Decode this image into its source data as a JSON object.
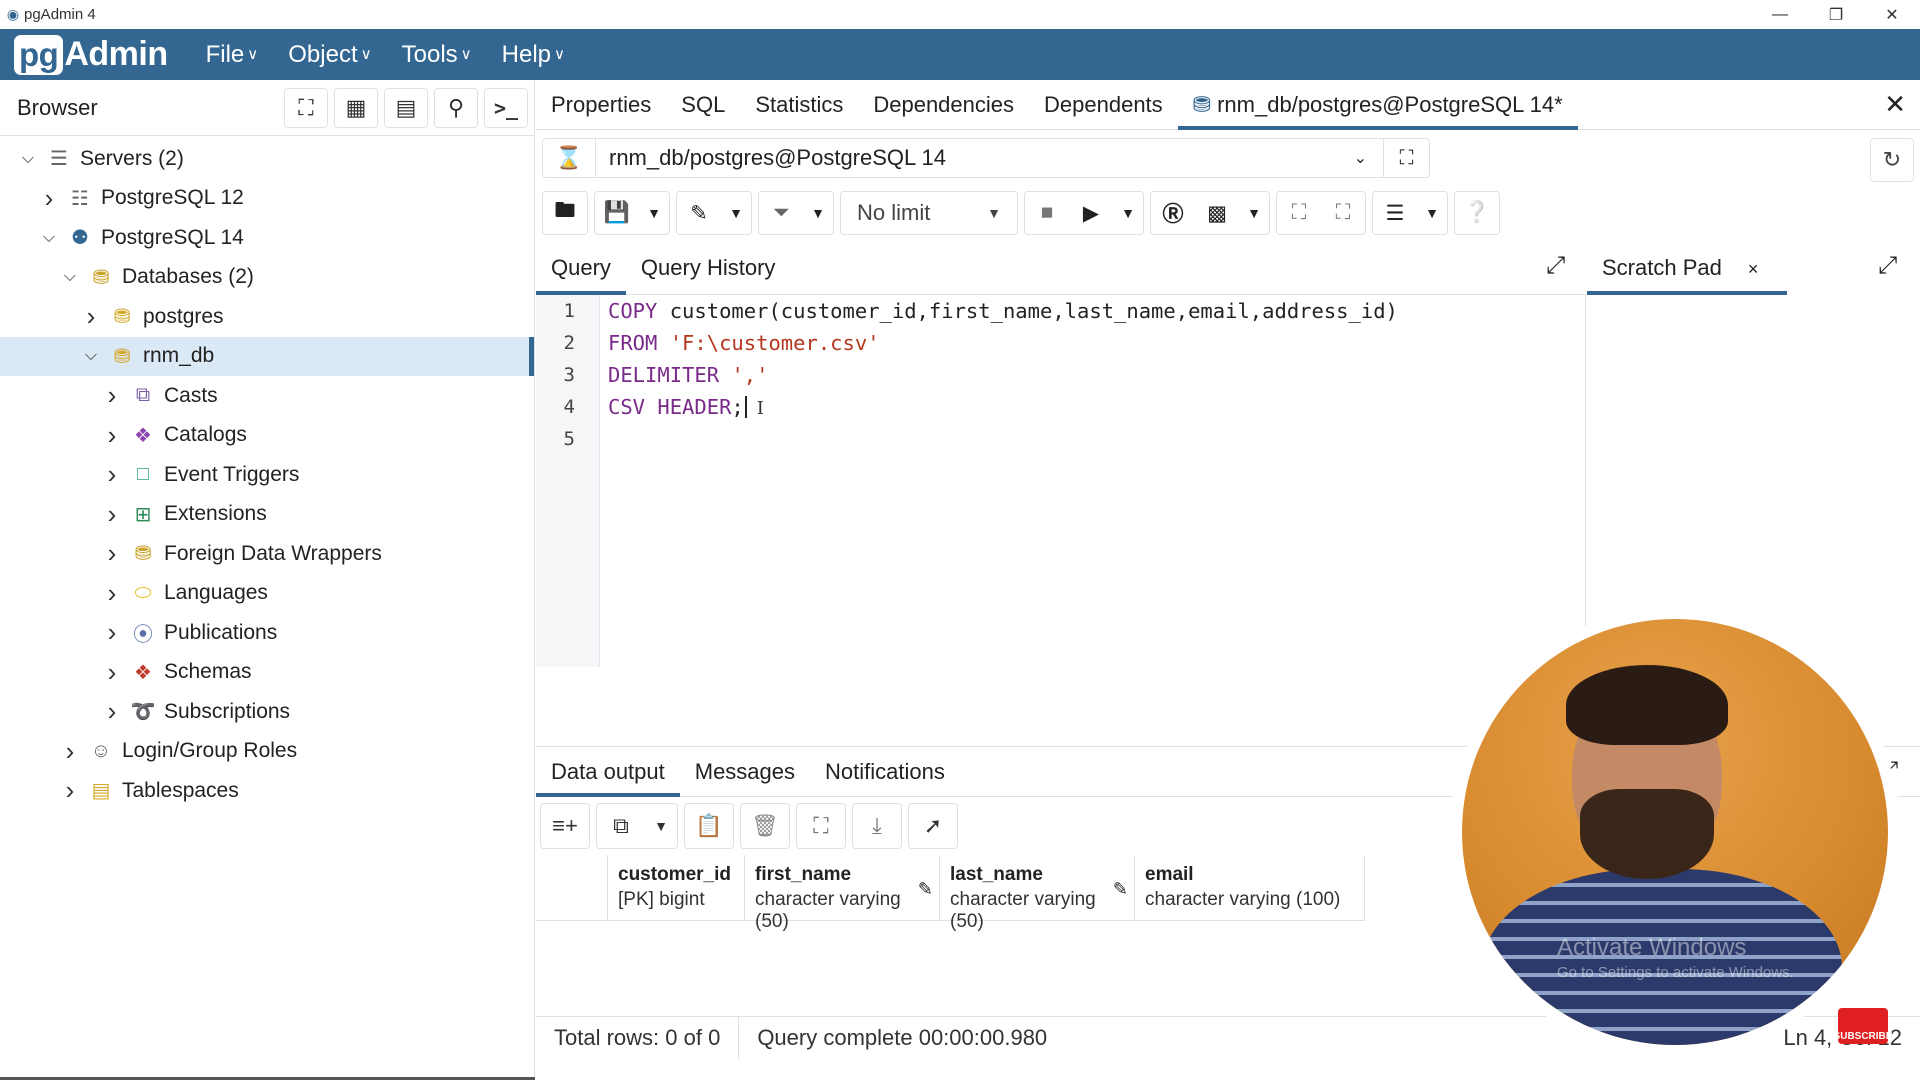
{
  "window": {
    "title": "pgAdmin 4",
    "controls": {
      "minimize": "—",
      "maximize": "❐",
      "close": "✕"
    }
  },
  "menubar": {
    "logo_pg": "pg",
    "logo_text": "Admin",
    "items": [
      "File",
      "Object",
      "Tools",
      "Help"
    ]
  },
  "browser": {
    "title": "Browser",
    "tree": [
      {
        "label": "Servers (2)",
        "icon": "servers-icon",
        "level": 0,
        "expanded": true
      },
      {
        "label": "PostgreSQL 12",
        "icon": "server-disconnected-icon",
        "level": 1,
        "expanded": false
      },
      {
        "label": "PostgreSQL 14",
        "icon": "elephant-icon",
        "level": 1,
        "expanded": true
      },
      {
        "label": "Databases (2)",
        "icon": "databases-icon",
        "level": 2,
        "expanded": true
      },
      {
        "label": "postgres",
        "icon": "database-icon",
        "level": 3,
        "expanded": false
      },
      {
        "label": "rnm_db",
        "icon": "database-icon",
        "level": 3,
        "expanded": true,
        "selected": true
      },
      {
        "label": "Casts",
        "icon": "casts-icon",
        "level": 4,
        "expanded": false
      },
      {
        "label": "Catalogs",
        "icon": "catalogs-icon",
        "level": 4,
        "expanded": false
      },
      {
        "label": "Event Triggers",
        "icon": "event-triggers-icon",
        "level": 4,
        "expanded": false
      },
      {
        "label": "Extensions",
        "icon": "extensions-icon",
        "level": 4,
        "expanded": false
      },
      {
        "label": "Foreign Data Wrappers",
        "icon": "fdw-icon",
        "level": 4,
        "expanded": false
      },
      {
        "label": "Languages",
        "icon": "languages-icon",
        "level": 4,
        "expanded": false
      },
      {
        "label": "Publications",
        "icon": "publications-icon",
        "level": 4,
        "expanded": false
      },
      {
        "label": "Schemas",
        "icon": "schemas-icon",
        "level": 4,
        "expanded": false
      },
      {
        "label": "Subscriptions",
        "icon": "subscriptions-icon",
        "level": 4,
        "expanded": false
      },
      {
        "label": "Login/Group Roles",
        "icon": "roles-icon",
        "level": 2,
        "expanded": false
      },
      {
        "label": "Tablespaces",
        "icon": "tablespaces-icon",
        "level": 2,
        "expanded": false
      }
    ]
  },
  "main_tabs": [
    {
      "label": "Properties"
    },
    {
      "label": "SQL"
    },
    {
      "label": "Statistics"
    },
    {
      "label": "Dependencies"
    },
    {
      "label": "Dependents"
    },
    {
      "label": "rnm_db/postgres@PostgreSQL 14*",
      "active": true
    }
  ],
  "connection": {
    "value": "rnm_db/postgres@PostgreSQL 14"
  },
  "toolbar": {
    "limit": "No limit"
  },
  "query_tabs": {
    "query": "Query",
    "history": "Query History"
  },
  "scratch_pad": {
    "label": "Scratch Pad",
    "close": "×"
  },
  "editor": {
    "lines": [
      [
        {
          "t": "COPY",
          "c": "kw"
        },
        {
          "t": " customer(customer_id,first_name,last_name,email,address_id)",
          "c": ""
        }
      ],
      [
        {
          "t": "FROM",
          "c": "kw"
        },
        {
          "t": " ",
          "c": ""
        },
        {
          "t": "'F:\\customer.csv'",
          "c": "str"
        }
      ],
      [
        {
          "t": "DELIMITER",
          "c": "kw"
        },
        {
          "t": " ",
          "c": ""
        },
        {
          "t": "','",
          "c": "str"
        }
      ],
      [
        {
          "t": "CSV HEADER",
          "c": "kw"
        },
        {
          "t": ";",
          "c": ""
        }
      ],
      []
    ]
  },
  "results": {
    "tabs": [
      "Data output",
      "Messages",
      "Notifications"
    ],
    "columns": [
      {
        "name": "customer_id",
        "type": "[PK] bigint"
      },
      {
        "name": "first_name",
        "type": "character varying (50)"
      },
      {
        "name": "last_name",
        "type": "character varying (50)"
      },
      {
        "name": "email",
        "type": "character varying (100)"
      }
    ]
  },
  "status": {
    "total_rows": "Total rows: 0 of 0",
    "query_complete": "Query complete 00:00:00.980",
    "cursor": "Ln 4, Col 12"
  },
  "overlay": {
    "watermark_1": "Activate Windows",
    "watermark_2": "Go to Settings to activate Windows.",
    "badge": "SUBSCRIBE"
  }
}
